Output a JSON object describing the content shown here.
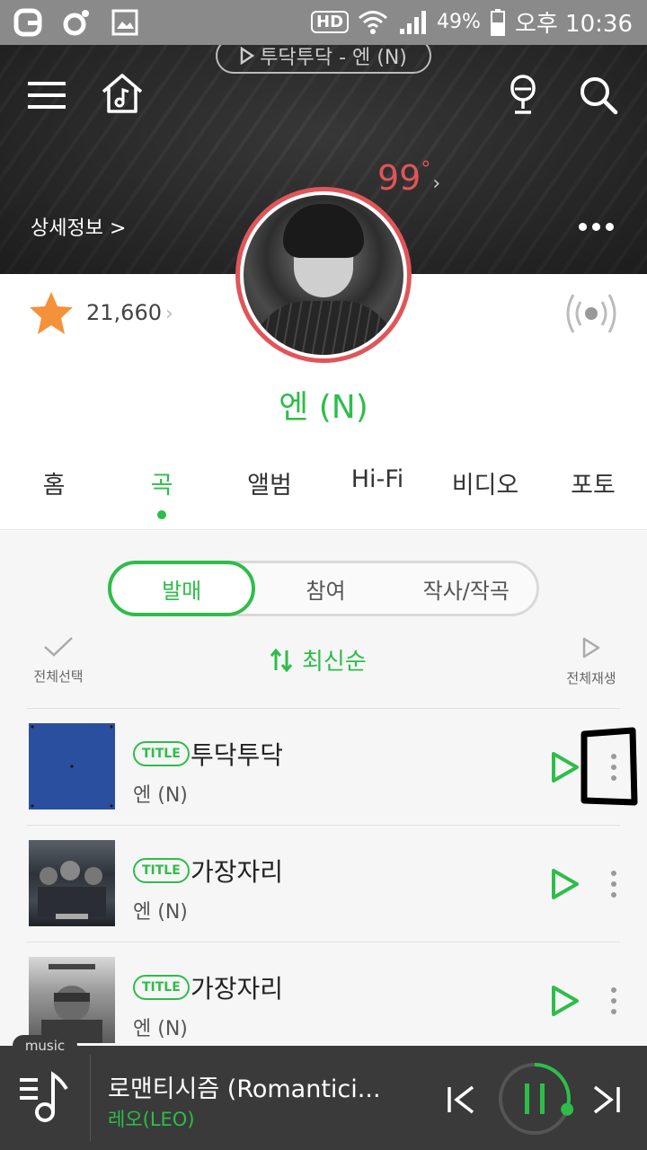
{
  "status_bar": {
    "hd": "HD",
    "battery": "49%",
    "time": "오후 10:36"
  },
  "header": {
    "now_playing": "투닥투닥 - 엔 (N)",
    "temperature": "99",
    "temperature_unit": "°",
    "detail_link": "상세정보 >"
  },
  "artist": {
    "name": "엔 (N)",
    "fan_count": "21,660"
  },
  "tabs": [
    {
      "label": "홈",
      "active": false
    },
    {
      "label": "곡",
      "active": true
    },
    {
      "label": "앨범",
      "active": false
    },
    {
      "label": "Hi-Fi",
      "active": false
    },
    {
      "label": "비디오",
      "active": false
    },
    {
      "label": "포토",
      "active": false
    }
  ],
  "segments": [
    {
      "label": "발매",
      "active": true
    },
    {
      "label": "참여",
      "active": false
    },
    {
      "label": "작사/작곡",
      "active": false
    }
  ],
  "toolbar": {
    "select_all": "전체선택",
    "sort": "최신순",
    "play_all": "전체재생"
  },
  "songs": [
    {
      "badge": "TITLE",
      "title": "투닥투닥",
      "artist": "엔 (N)",
      "cover_color": "#2a4f9e"
    },
    {
      "badge": "TITLE",
      "title": "가장자리",
      "artist": "엔 (N)",
      "cover_color": "#3c4048"
    },
    {
      "badge": "TITLE",
      "title": "가장자리",
      "artist": "엔 (N)",
      "cover_color": "#8c8c8c"
    }
  ],
  "mini_player": {
    "tag": "music",
    "title": "로맨티시즘 (Romantici...",
    "artist": "레오(LEO)",
    "progress": 0.3
  },
  "colors": {
    "accent": "#2ebd4a",
    "avatar_ring": "#e0555a",
    "star": "#f5913a"
  }
}
